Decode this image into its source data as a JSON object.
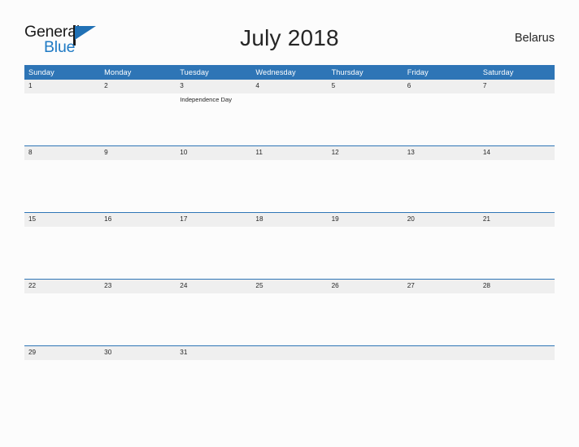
{
  "brand": {
    "name_top": "General",
    "name_bottom": "Blue",
    "flag_icon": "flag-triangle-icon",
    "accent_color": "#2171b5"
  },
  "header": {
    "title": "July 2018",
    "country": "Belarus"
  },
  "theme": {
    "header_bg": "#2e75b6",
    "header_text": "#ffffff",
    "daynum_bg": "#efefef",
    "row_divider": "#2e75b6",
    "page_bg": "#fcfcfc",
    "text": "#262626"
  },
  "calendar": {
    "month": "July",
    "year": "2018",
    "weekday_headers": [
      "Sunday",
      "Monday",
      "Tuesday",
      "Wednesday",
      "Thursday",
      "Friday",
      "Saturday"
    ],
    "weeks": [
      {
        "days": [
          {
            "num": "1",
            "events": []
          },
          {
            "num": "2",
            "events": []
          },
          {
            "num": "3",
            "events": [
              "Independence Day"
            ]
          },
          {
            "num": "4",
            "events": []
          },
          {
            "num": "5",
            "events": []
          },
          {
            "num": "6",
            "events": []
          },
          {
            "num": "7",
            "events": []
          }
        ]
      },
      {
        "days": [
          {
            "num": "8",
            "events": []
          },
          {
            "num": "9",
            "events": []
          },
          {
            "num": "10",
            "events": []
          },
          {
            "num": "11",
            "events": []
          },
          {
            "num": "12",
            "events": []
          },
          {
            "num": "13",
            "events": []
          },
          {
            "num": "14",
            "events": []
          }
        ]
      },
      {
        "days": [
          {
            "num": "15",
            "events": []
          },
          {
            "num": "16",
            "events": []
          },
          {
            "num": "17",
            "events": []
          },
          {
            "num": "18",
            "events": []
          },
          {
            "num": "19",
            "events": []
          },
          {
            "num": "20",
            "events": []
          },
          {
            "num": "21",
            "events": []
          }
        ]
      },
      {
        "days": [
          {
            "num": "22",
            "events": []
          },
          {
            "num": "23",
            "events": []
          },
          {
            "num": "24",
            "events": []
          },
          {
            "num": "25",
            "events": []
          },
          {
            "num": "26",
            "events": []
          },
          {
            "num": "27",
            "events": []
          },
          {
            "num": "28",
            "events": []
          }
        ]
      },
      {
        "days": [
          {
            "num": "29",
            "events": []
          },
          {
            "num": "30",
            "events": []
          },
          {
            "num": "31",
            "events": []
          },
          {
            "num": "",
            "events": []
          },
          {
            "num": "",
            "events": []
          },
          {
            "num": "",
            "events": []
          },
          {
            "num": "",
            "events": []
          }
        ]
      }
    ]
  }
}
